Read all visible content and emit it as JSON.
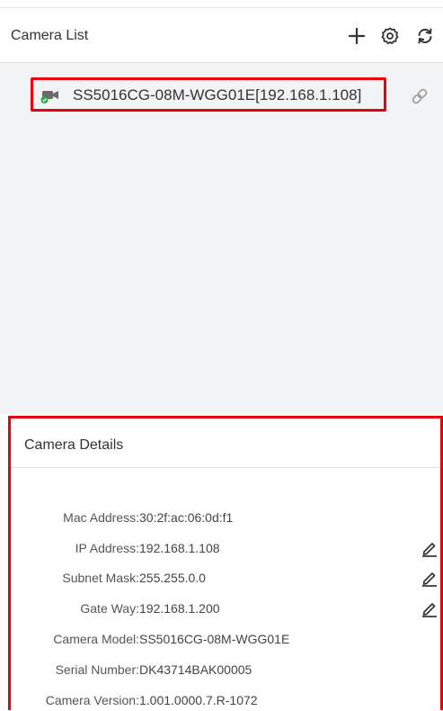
{
  "header": {
    "title": "Camera List"
  },
  "camera_list": {
    "items": [
      {
        "label": "SS5016CG-08M-WGG01E[192.168.1.108]",
        "status_color": "#2ea84a"
      }
    ]
  },
  "details": {
    "title": "Camera Details",
    "rows": [
      {
        "label": "Mac Address:",
        "value": "30:2f:ac:06:0d:f1"
      },
      {
        "label": "IP Address:",
        "value": "192.168.1.108"
      },
      {
        "label": "Subnet Mask:",
        "value": "255.255.0.0"
      },
      {
        "label": "Gate Way:",
        "value": "192.168.1.200"
      },
      {
        "label": "Camera Model:",
        "value": "SS5016CG-08M-WGG01E"
      },
      {
        "label": "Serial Number:",
        "value": "DK43714BAK00005"
      },
      {
        "label": "Camera Version:",
        "value": "1.001.0000.7.R-1072"
      }
    ]
  },
  "icons": {
    "add": "plus-icon",
    "settings": "gear-icon",
    "refresh": "refresh-icon",
    "camera": "camera-icon",
    "link": "link-icon",
    "edit": "pencil-icon"
  },
  "colors": {
    "highlight": "#e8000b",
    "list_bg": "#f2f3f5",
    "online": "#2ea84a"
  }
}
